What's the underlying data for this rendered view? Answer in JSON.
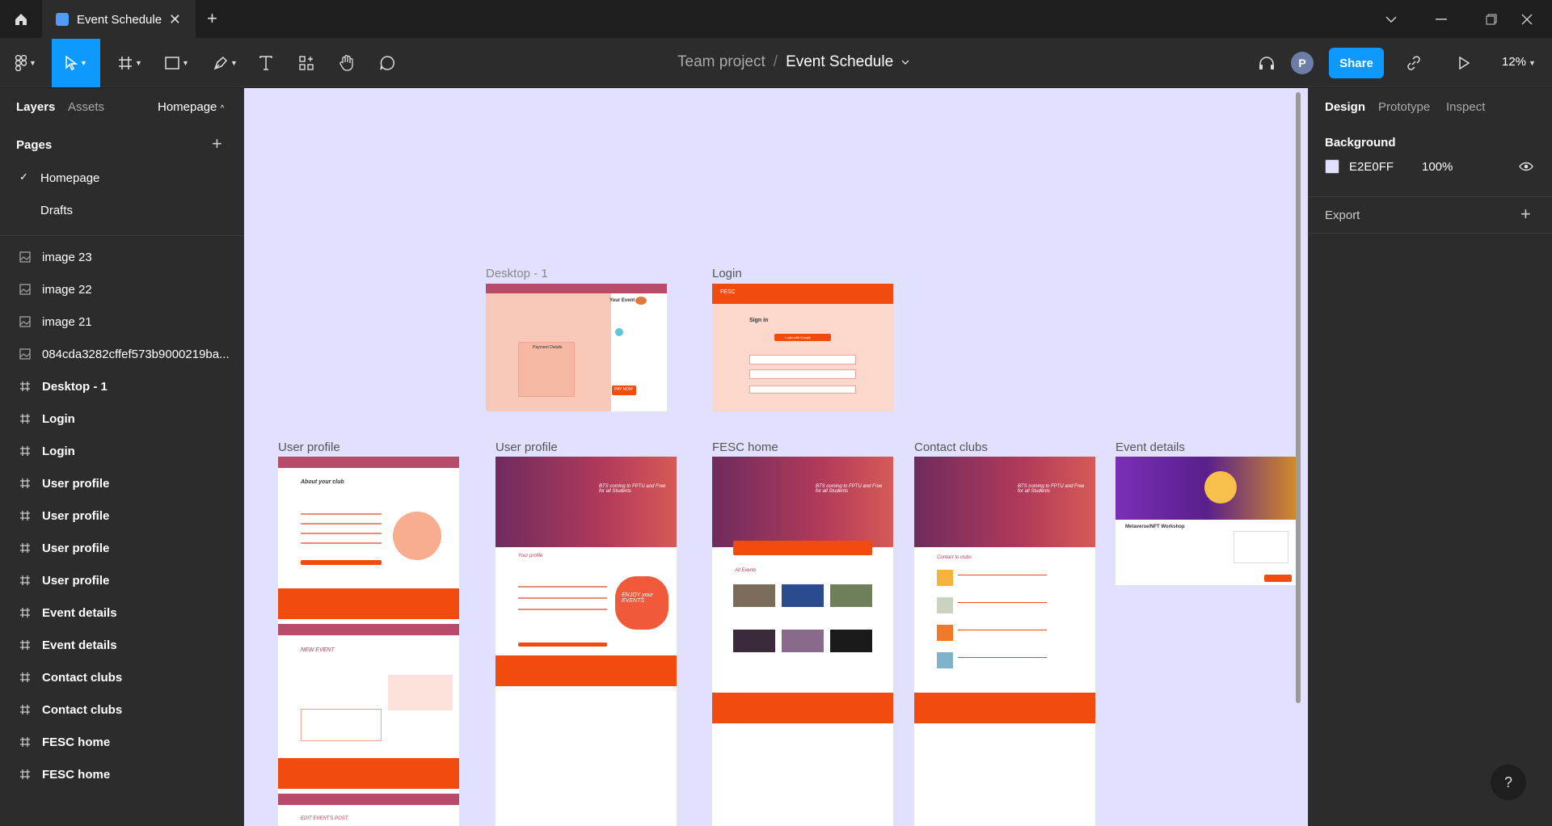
{
  "titlebar": {
    "tab_title": "Event Schedule",
    "home_icon": "home-icon",
    "close_icon": "close-icon",
    "new_tab_icon": "plus-icon"
  },
  "toolbar": {
    "breadcrumb_project": "Team project",
    "breadcrumb_separator": "/",
    "breadcrumb_file": "Event Schedule",
    "avatar_initial": "P",
    "share_label": "Share",
    "zoom": "12%",
    "accent": "#0d99ff"
  },
  "left_panel": {
    "tab_layers": "Layers",
    "tab_assets": "Assets",
    "current_page": "Homepage",
    "pages_title": "Pages",
    "pages": [
      "Homepage",
      "Drafts"
    ],
    "selected_page": "Homepage",
    "layers": [
      {
        "type": "image",
        "label": "image 23"
      },
      {
        "type": "image",
        "label": "image 22"
      },
      {
        "type": "image",
        "label": "image 21"
      },
      {
        "type": "image",
        "label": "084cda3282cffef573b9000219ba..."
      },
      {
        "type": "frame",
        "label": "Desktop - 1"
      },
      {
        "type": "frame",
        "label": "Login"
      },
      {
        "type": "frame",
        "label": "Login"
      },
      {
        "type": "frame",
        "label": "User profile"
      },
      {
        "type": "frame",
        "label": "User profile"
      },
      {
        "type": "frame",
        "label": "User profile"
      },
      {
        "type": "frame",
        "label": "User profile"
      },
      {
        "type": "frame",
        "label": "Event details"
      },
      {
        "type": "frame",
        "label": "Event details"
      },
      {
        "type": "frame",
        "label": "Contact clubs"
      },
      {
        "type": "frame",
        "label": "Contact clubs"
      },
      {
        "type": "frame",
        "label": "FESC home"
      },
      {
        "type": "frame",
        "label": "FESC home"
      }
    ]
  },
  "canvas": {
    "background": "#e2e0ff",
    "frame_labels": {
      "desktop1": "Desktop - 1",
      "login": "Login",
      "user_profile_1": "User profile",
      "user_profile_2": "User profile",
      "fesc_home": "FESC home",
      "contact_clubs": "Contact clubs",
      "event_details": "Event details"
    },
    "thumb_text": {
      "desktop_your_event": "Your Event",
      "desktop_payment": "Payment Details",
      "desktop_pay": "PAY NOW",
      "login_brand": "FESC",
      "login_title": "Sign in",
      "login_google": "Login with Google",
      "about_club": "About your club",
      "new_event": "NEW EVENT",
      "edit_event": "EDIT EVENT'S POST",
      "hero_text": "BTS coming to FPTU and Free for all Students",
      "your_profile": "Your profile",
      "enjoy": "ENJOY your EVENTS",
      "all_events": "All Events",
      "contact_to_clubs": "Contact to clubs",
      "metaverse": "Metaverse/NFT Workshop"
    }
  },
  "right_panel": {
    "tab_design": "Design",
    "tab_prototype": "Prototype",
    "tab_inspect": "Inspect",
    "background_title": "Background",
    "bg_hex": "E2E0FF",
    "bg_opacity": "100%",
    "export_title": "Export"
  },
  "help_label": "?"
}
